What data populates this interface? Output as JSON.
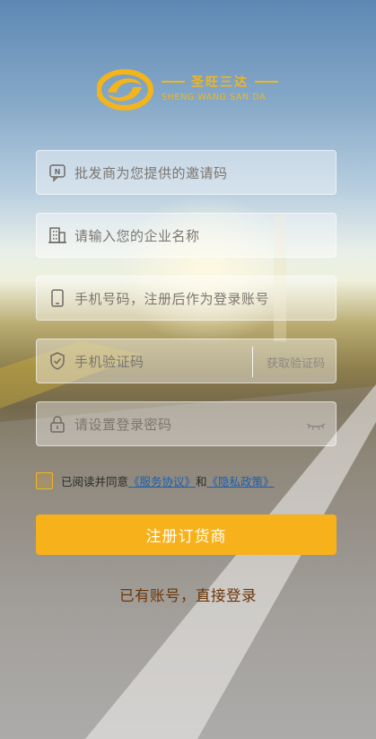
{
  "logo": {
    "name_cn": "圣旺三达",
    "name_en": "SHENG WANG SAN DA",
    "icon": "brand-swirl-logo"
  },
  "form": {
    "invite_code": {
      "placeholder": "批发商为您提供的邀请码",
      "icon": "message-n-icon"
    },
    "company_name": {
      "placeholder": "请输入您的企业名称",
      "icon": "building-icon"
    },
    "phone": {
      "placeholder": "手机号码，注册后作为登录账号",
      "icon": "phone-icon"
    },
    "sms_code": {
      "placeholder": "手机验证码",
      "icon": "shield-check-icon",
      "get_code_label": "获取验证码"
    },
    "password": {
      "placeholder": "请设置登录密码",
      "icon": "lock-icon",
      "toggle_icon": "eye-closed-icon"
    }
  },
  "agreement": {
    "prefix": "已阅读并同意",
    "service_link": "《服务协议》",
    "and": "和",
    "privacy_link": "《隐私政策》",
    "checked": false
  },
  "register_button": "注册订货商",
  "login_link": "已有账号，直接登录",
  "colors": {
    "accent": "#f7b11a",
    "link": "#1a5fb0",
    "login_text": "#6b3608"
  }
}
